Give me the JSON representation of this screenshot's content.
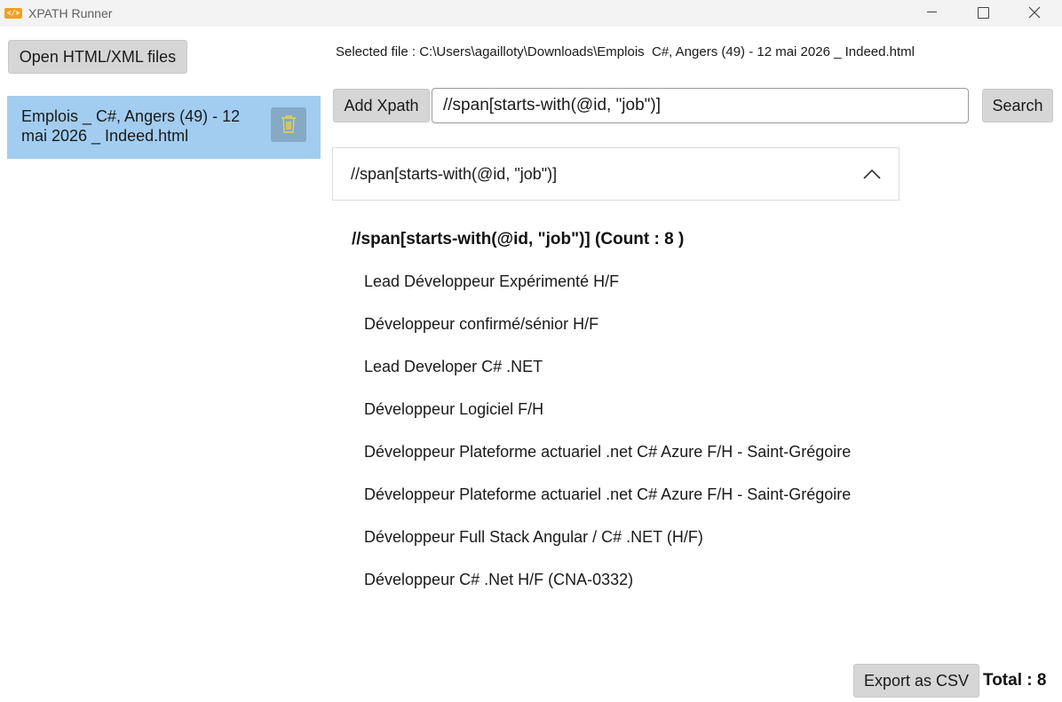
{
  "window": {
    "icon_glyph": "</>",
    "title": "XPATH Runner"
  },
  "sidebar": {
    "open_button_label": "Open HTML/XML files",
    "files": [
      {
        "name": "Emplois _ C#, Angers (49) - 12 mai 2026 _ Indeed.html"
      }
    ]
  },
  "main": {
    "selected_file_label": "Selected file : ",
    "selected_file_path": "C:\\Users\\agailloty\\Downloads\\Emplois  C#, Angers (49) - 12 mai 2026 _ Indeed.html",
    "add_xpath_label": "Add Xpath",
    "xpath_value": "//span[starts-with(@id, \"job\")]",
    "search_label": "Search",
    "accordion_title": "//span[starts-with(@id, \"job\")]",
    "results_header": "//span[starts-with(@id, \"job\")] (Count : 8 )",
    "results": [
      "Lead Développeur Expérimenté H/F",
      "Développeur confirmé/sénior H/F",
      "Lead Developer C# .NET",
      "Développeur Logiciel F/H",
      "Développeur Plateforme actuariel .net C# Azure F/H - Saint-Grégoire",
      "Développeur Plateforme actuariel .net C# Azure F/H - Saint-Grégoire",
      "Développeur Full Stack Angular / C# .NET (H/F)",
      "Développeur C# .Net H/F (CNA-0332)"
    ]
  },
  "footer": {
    "export_label": "Export as CSV",
    "total_label": "Total : 8"
  },
  "colors": {
    "selected_file_bg": "#a2cdf0",
    "delete_button_bg": "#86a9c4",
    "trash_icon": "#e8d24a",
    "button_bg": "#d6d6d6",
    "app_icon": "#f0a020"
  }
}
